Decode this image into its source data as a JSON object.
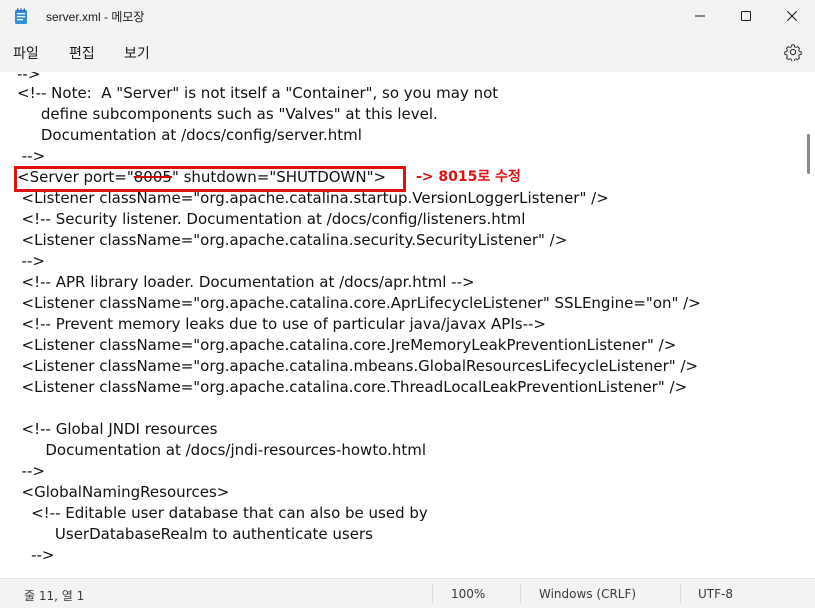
{
  "window": {
    "title": "server.xml - 메모장",
    "icon": "notepad-icon"
  },
  "menu": {
    "file": "파일",
    "edit": "편집",
    "view": "보기",
    "settings_icon": "gear-icon"
  },
  "editor": {
    "lines": [
      "-->",
      "<!-- Note:  A \"Server\" is not itself a \"Container\", so you may not",
      "     define subcomponents such as \"Valves\" at this level.",
      "     Documentation at /docs/config/server.html",
      " -->",
      "",
      "  <Listener className=\"org.apache.catalina.startup.VersionLoggerListener\" />",
      "  <!-- Security listener. Documentation at /docs/config/listeners.html",
      "  <Listener className=\"org.apache.catalina.security.SecurityListener\" />",
      "  -->",
      "  <!-- APR library loader. Documentation at /docs/apr.html -->",
      "  <Listener className=\"org.apache.catalina.core.AprLifecycleListener\" SSLEngine=\"on\" />",
      "  <!-- Prevent memory leaks due to use of particular java/javax APIs-->",
      "  <Listener className=\"org.apache.catalina.core.JreMemoryLeakPreventionListener\" />",
      "  <Listener className=\"org.apache.catalina.mbeans.GlobalResourcesLifecycleListener\" />",
      "  <Listener className=\"org.apache.catalina.core.ThreadLocalLeakPreventionListener\" />",
      "",
      "  <!-- Global JNDI resources",
      "       Documentation at /docs/jndi-resources-howto.html",
      "  -->",
      "  <GlobalNamingResources>",
      "    <!-- Editable user database that can also be used by",
      "         UserDatabaseRealm to authenticate users",
      "    -->"
    ],
    "server_line": {
      "prefix": "<Server port=\"",
      "old_port": "8005",
      "suffix": "\" shutdown=\"SHUTDOWN\">"
    },
    "annotation": "-> 8015로 수정",
    "annotation_color": "#e01010"
  },
  "status": {
    "position": "줄 11, 열 1",
    "zoom": "100%",
    "line_ending": "Windows (CRLF)",
    "encoding": "UTF-8"
  }
}
